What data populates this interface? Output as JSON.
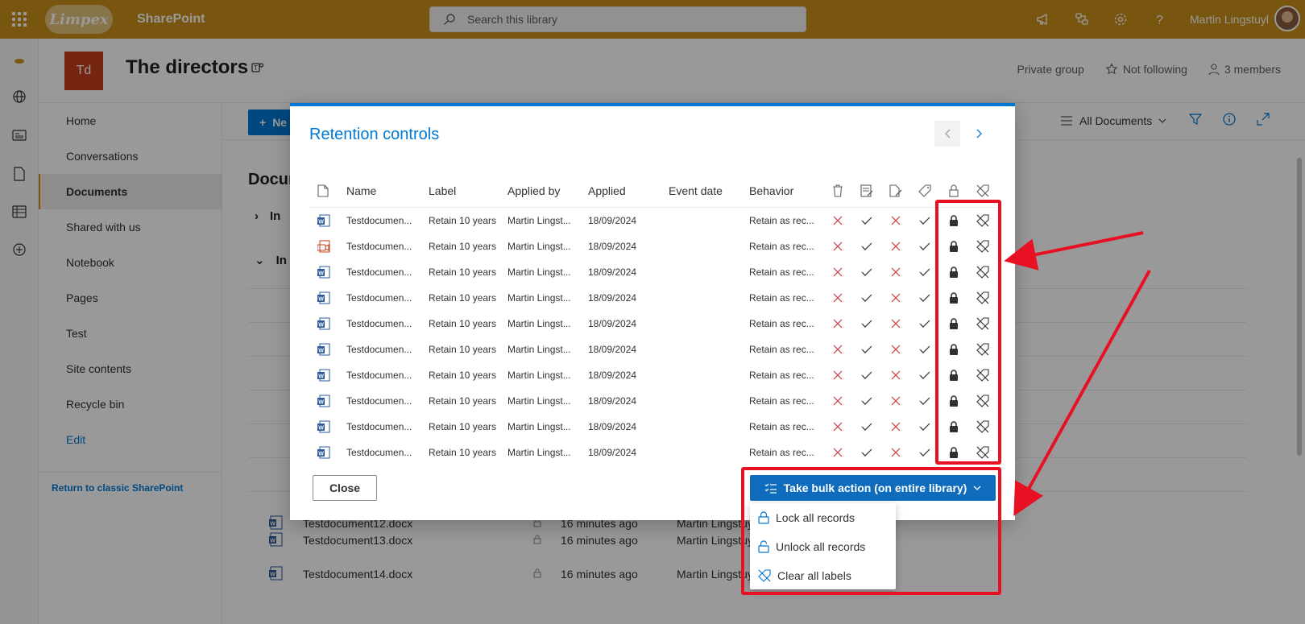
{
  "topbar": {
    "logo_text": "Limpex",
    "app_name": "SharePoint",
    "search_placeholder": "Search this library",
    "user_name": "Martin Lingstuyl"
  },
  "site": {
    "logo_initials": "Td",
    "title": "The directors",
    "privacy": "Private group",
    "follow": "Not following",
    "members": "3 members"
  },
  "nav": {
    "items": [
      "Home",
      "Conversations",
      "Documents",
      "Shared with us",
      "Notebook",
      "Pages",
      "Test",
      "Site contents",
      "Recycle bin"
    ],
    "edit": "Edit",
    "classic": "Return to classic SharePoint"
  },
  "library": {
    "new_label": "Ne",
    "view": "All Documents",
    "title": "Docum",
    "group1": "In",
    "group2": "In s",
    "rows": [
      {
        "name": "Testdocument12.docx",
        "modified": "16 minutes ago",
        "by": "Martin Lingstuyl"
      },
      {
        "name": "Testdocument13.docx",
        "modified": "16 minutes ago",
        "by": "Martin Lingstuyl"
      },
      {
        "name": "Testdocument14.docx",
        "modified": "16 minutes ago",
        "by": "Martin Lingstuyl"
      }
    ]
  },
  "dialog": {
    "title": "Retention controls",
    "columns": {
      "name": "Name",
      "label": "Label",
      "applied_by": "Applied by",
      "applied": "Applied",
      "event_date": "Event date",
      "behavior": "Behavior"
    },
    "column_icons": [
      "delete-icon",
      "edit-properties-icon",
      "edit-content-icon",
      "tag-icon",
      "lock-icon",
      "clear-label-icon"
    ],
    "rows": [
      {
        "icon": "word",
        "name": "Testdocumen...",
        "label": "Retain 10 years",
        "by": "Martin Lingst...",
        "applied": "18/09/2024",
        "event": "",
        "behavior": "Retain as rec..."
      },
      {
        "icon": "video",
        "name": "Testdocumen...",
        "label": "Retain 10 years",
        "by": "Martin Lingst...",
        "applied": "18/09/2024",
        "event": "",
        "behavior": "Retain as rec..."
      },
      {
        "icon": "word",
        "name": "Testdocumen...",
        "label": "Retain 10 years",
        "by": "Martin Lingst...",
        "applied": "18/09/2024",
        "event": "",
        "behavior": "Retain as rec..."
      },
      {
        "icon": "word",
        "name": "Testdocumen...",
        "label": "Retain 10 years",
        "by": "Martin Lingst...",
        "applied": "18/09/2024",
        "event": "",
        "behavior": "Retain as rec..."
      },
      {
        "icon": "word",
        "name": "Testdocumen...",
        "label": "Retain 10 years",
        "by": "Martin Lingst...",
        "applied": "18/09/2024",
        "event": "",
        "behavior": "Retain as rec..."
      },
      {
        "icon": "word",
        "name": "Testdocumen...",
        "label": "Retain 10 years",
        "by": "Martin Lingst...",
        "applied": "18/09/2024",
        "event": "",
        "behavior": "Retain as rec..."
      },
      {
        "icon": "word",
        "name": "Testdocumen...",
        "label": "Retain 10 years",
        "by": "Martin Lingst...",
        "applied": "18/09/2024",
        "event": "",
        "behavior": "Retain as rec..."
      },
      {
        "icon": "word",
        "name": "Testdocumen...",
        "label": "Retain 10 years",
        "by": "Martin Lingst...",
        "applied": "18/09/2024",
        "event": "",
        "behavior": "Retain as rec..."
      },
      {
        "icon": "word",
        "name": "Testdocumen...",
        "label": "Retain 10 years",
        "by": "Martin Lingst...",
        "applied": "18/09/2024",
        "event": "",
        "behavior": "Retain as rec..."
      },
      {
        "icon": "word",
        "name": "Testdocumen...",
        "label": "Retain 10 years",
        "by": "Martin Lingst...",
        "applied": "18/09/2024",
        "event": "",
        "behavior": "Retain as rec..."
      }
    ],
    "close_label": "Close",
    "bulk_label": "Take bulk action (on entire library)",
    "bulk_menu": [
      {
        "icon": "lock-icon",
        "label": "Lock all records"
      },
      {
        "icon": "unlock-icon",
        "label": "Unlock all records"
      },
      {
        "icon": "clear-label-icon",
        "label": "Clear all labels"
      }
    ]
  },
  "colors": {
    "suite_bar": "#c98f1b",
    "accent": "#0078d4",
    "annotation_red": "#e81123",
    "cross_red": "#d13438"
  }
}
